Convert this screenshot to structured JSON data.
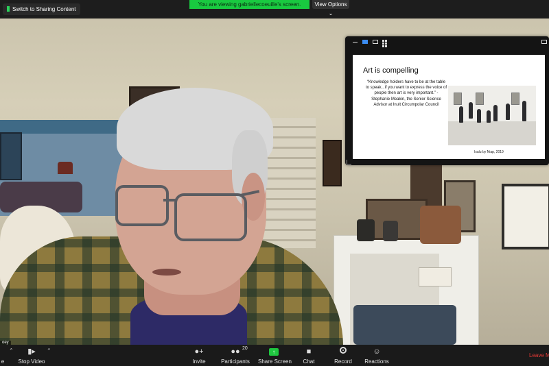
{
  "topbar": {
    "switch_button": "Switch to Sharing Content",
    "viewing_banner": "You are viewing gabriellecoeuille's screen.",
    "view_options": "View Options",
    "view_options_icon": "chevron-down-icon"
  },
  "shared_slide": {
    "title": "Art is compelling",
    "quote": "“Knowledge holders have to be at the table to speak...if you want to express the voice of people then art is very important.” - Stephanie Meakin, the Senior Science Advisor at Inuit Circumpolar Council",
    "caption": "Isalu by Niap, 2019"
  },
  "video": {
    "name_tag": "oey"
  },
  "toolbar": {
    "mute_label": "e",
    "stop_video_label": "Stop Video",
    "invite_label": "Invite",
    "participants_label": "Participants",
    "participants_count": "20",
    "share_screen_label": "Share Screen",
    "chat_label": "Chat",
    "record_label": "Record",
    "reactions_label": "Reactions",
    "leave_label": "Leave M",
    "icons": {
      "video": "video-camera-icon",
      "invite": "add-user-icon",
      "participants": "participants-icon",
      "share": "share-screen-icon",
      "chat": "chat-bubble-icon",
      "record": "record-icon",
      "reactions": "add-reaction-icon"
    }
  },
  "colors": {
    "accent_green": "#1fc740",
    "leave_red": "#e53935",
    "toolbar_bg": "#1a1a1a"
  }
}
